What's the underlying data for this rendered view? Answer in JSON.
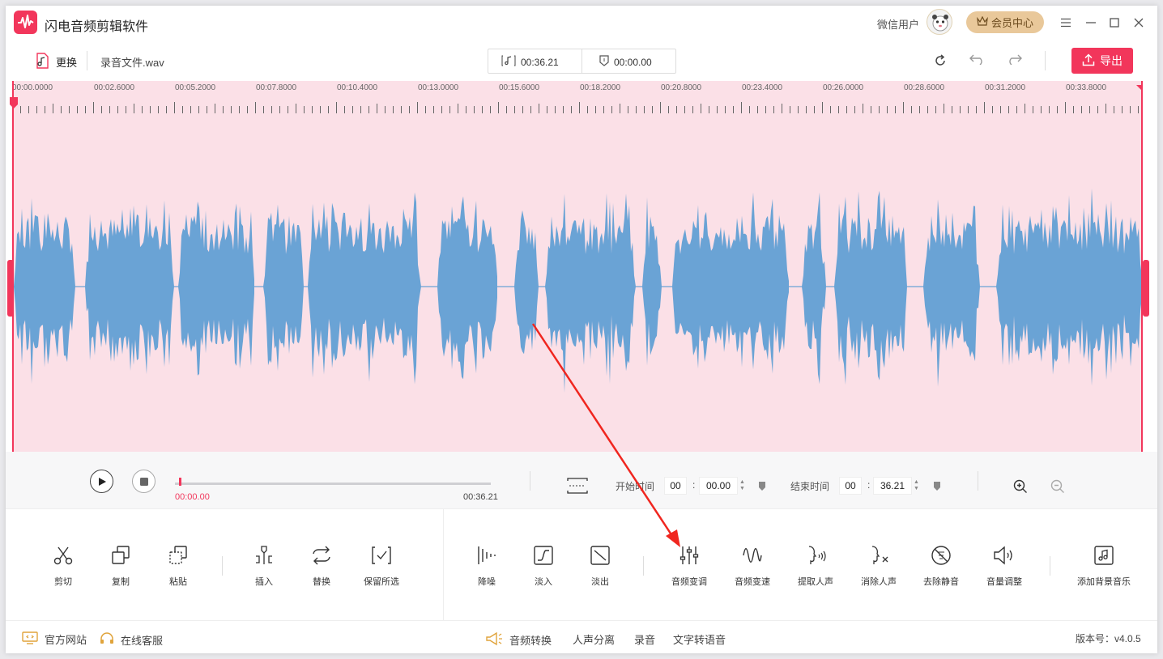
{
  "app": {
    "title": "闪电音频剪辑软件",
    "user_name": "微信用户",
    "vip_label": "会员中心"
  },
  "toolbar": {
    "change_label": "更换",
    "filename": "录音文件.wav",
    "duration": "00:36.21",
    "cursor_time": "00:00.00",
    "export_label": "导出"
  },
  "ruler": {
    "labels": [
      "00:00.0000",
      "00:02.6000",
      "00:05.2000",
      "00:07.8000",
      "00:10.4000",
      "00:13.0000",
      "00:15.6000",
      "00:18.2000",
      "00:20.8000",
      "00:23.4000",
      "00:26.0000",
      "00:28.6000",
      "00:31.2000",
      "00:33.8000"
    ]
  },
  "waveform": {
    "color": "#6aa3d5",
    "background": "#fbe0e7",
    "selection_color": "#f2365b"
  },
  "playback": {
    "current_time": "00:00.00",
    "total_time": "00:36.21",
    "progress": 0,
    "start_label": "开始时间",
    "start_min": "00",
    "start_sec": "00.00",
    "end_label": "结束时间",
    "end_min": "00",
    "end_sec": "36.21"
  },
  "edit_tools": [
    {
      "label": "剪切",
      "icon": "scissors-icon"
    },
    {
      "label": "复制",
      "icon": "copy-icon"
    },
    {
      "label": "粘贴",
      "icon": "paste-icon"
    },
    {
      "label": "插入",
      "icon": "insert-icon"
    },
    {
      "label": "替换",
      "icon": "replace-icon"
    },
    {
      "label": "保留所选",
      "icon": "keep-selection-icon"
    }
  ],
  "effect_tools": [
    {
      "label": "降噪",
      "icon": "denoise-icon"
    },
    {
      "label": "淡入",
      "icon": "fade-in-icon"
    },
    {
      "label": "淡出",
      "icon": "fade-out-icon"
    },
    {
      "label": "音频变调",
      "icon": "pitch-icon"
    },
    {
      "label": "音频变速",
      "icon": "speed-icon"
    },
    {
      "label": "提取人声",
      "icon": "extract-voice-icon"
    },
    {
      "label": "消除人声",
      "icon": "remove-voice-icon"
    },
    {
      "label": "去除静音",
      "icon": "remove-silence-icon"
    },
    {
      "label": "音量调整",
      "icon": "volume-icon"
    },
    {
      "label": "添加背景音乐",
      "icon": "bg-music-icon"
    }
  ],
  "status": {
    "website": "官方网站",
    "support": "在线客服",
    "links": [
      "音频转换",
      "人声分离",
      "录音",
      "文字转语音"
    ],
    "version": "版本号：v4.0.5"
  }
}
